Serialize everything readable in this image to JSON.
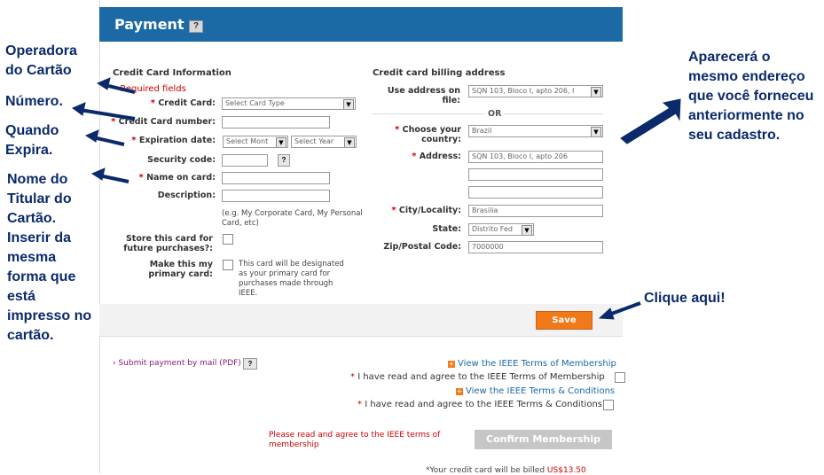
{
  "payment": {
    "title": "Payment",
    "help": "?",
    "cc_info_title": "Credit Card Information",
    "required_note": "Required fields",
    "fields": {
      "credit_card_label": "Credit Card:",
      "credit_card_value": "Select Card Type",
      "card_number_label": "Credit Card number:",
      "expiration_label": "Expiration date:",
      "exp_month": "Select Mont",
      "exp_year": "Select Year",
      "security_code_label": "Security code:",
      "security_help": "?",
      "name_on_card_label": "Name on card:",
      "description_label": "Description:",
      "description_hint": "(e.g. My Corporate Card, My Personal Card, etc)",
      "store_card_label": "Store this card for future purchases?:",
      "primary_card_label": "Make this my primary card:",
      "primary_card_hint": "This card will be designated as your primary card for purchases made through IEEE."
    },
    "billing": {
      "title": "Credit card billing address",
      "use_address_label": "Use address on file:",
      "use_address_value": "SQN 103, Bloco I, apto 206, I",
      "or": "OR",
      "country_label": "Choose your country:",
      "country_value": "Brazil",
      "address_label": "Address:",
      "address_value": "SQN 103, Bloco I, apto 206",
      "city_label": "City/Locality:",
      "city_value": "Brasilia",
      "state_label": "State:",
      "state_value": "Distrito Fed",
      "zip_label": "Zip/Postal Code:",
      "zip_value": "7000000"
    },
    "save": "Save",
    "submit_mail": "Submit payment by mail (PDF)",
    "submit_help": "?",
    "terms_membership_link": "View the IEEE Terms of Membership",
    "terms_membership_agree": "I have read and agree to the IEEE Terms of Membership",
    "terms_conditions_link": "View the IEEE Terms & Conditions",
    "terms_conditions_agree": "I have read and agree to the IEEE Terms & Conditions",
    "please_read": "Please read and agree to the IEEE terms of membership",
    "confirm": "Confirm Membership",
    "billed_note": "*Your credit card will be billed",
    "billed_amount": "US$13.50"
  },
  "annotations": {
    "operadora": "Operadora do Cartão",
    "numero": "Número.",
    "quando": "Quando Expira.",
    "nome": "Nome do Titular do Cartão. Inserir da mesma forma que está impresso no cartão.",
    "aparecera": "Aparecerá o mesmo endereço que você forneceu anteriormente no seu cadastro.",
    "clique": "Clique  aqui!"
  },
  "colors": {
    "header": "#1b6aa5",
    "save": "#f07a1a",
    "annotation": "#0a2a6b",
    "required": "#cc0000"
  }
}
